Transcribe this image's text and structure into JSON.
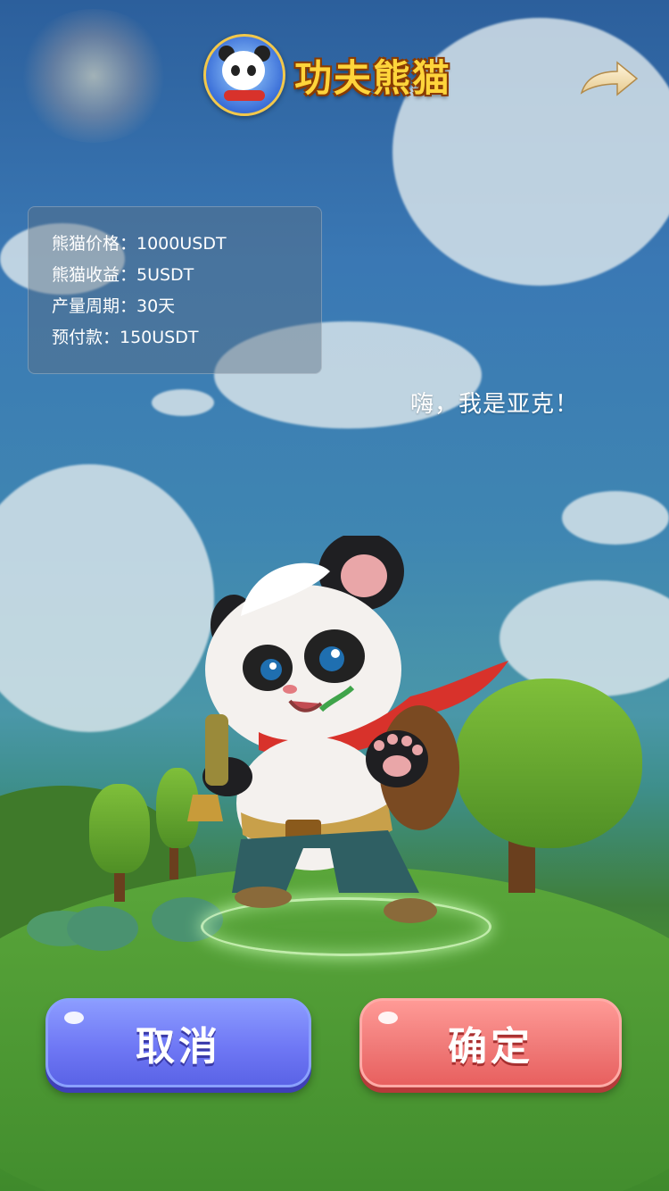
{
  "header": {
    "logo_title": "功夫熊猫",
    "share_icon": "share-arrow-icon"
  },
  "info": {
    "rows": [
      "熊猫价格：1000USDT",
      "熊猫收益：5USDT",
      "产量周期：30天",
      "预付款：150USDT"
    ]
  },
  "character": {
    "greeting": "嗨，我是亚克！"
  },
  "actions": {
    "cancel_label": "取消",
    "confirm_label": "确定"
  },
  "colors": {
    "cancel": "#6f78f5",
    "confirm": "#f07a78",
    "title": "#ffd43b"
  }
}
